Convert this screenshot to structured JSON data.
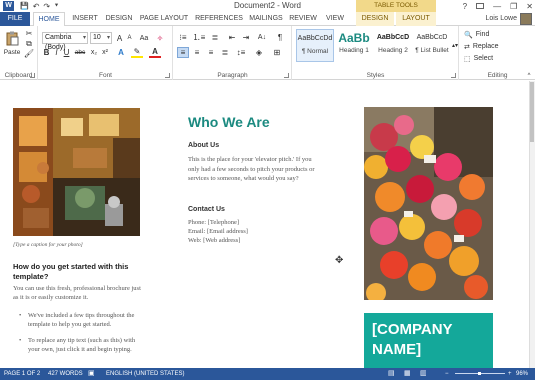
{
  "titlebar": {
    "app_icon": "W",
    "title": "Document2 - Word",
    "contextual_group": "TABLE TOOLS",
    "help": "?",
    "minimize": "—",
    "restore": "❐",
    "close": "✕"
  },
  "qat": {
    "save_icon": "💾",
    "undo_icon": "↶",
    "redo_icon": "↷",
    "more_icon": "⯆"
  },
  "tabs": {
    "file": "FILE",
    "home": "HOME",
    "insert": "INSERT",
    "design": "DESIGN",
    "page_layout": "PAGE LAYOUT",
    "references": "REFERENCES",
    "mailings": "MAILINGS",
    "review": "REVIEW",
    "view": "VIEW",
    "table_design": "DESIGN",
    "table_layout": "LAYOUT",
    "user": "Lois Lowe"
  },
  "ribbon": {
    "clipboard": {
      "label": "Clipboard",
      "paste": "Paste"
    },
    "font": {
      "label": "Font",
      "name": "Cambria (Body)",
      "size": "10",
      "grow": "A",
      "shrink": "A",
      "case": "Aa",
      "clear": "✧",
      "bold": "B",
      "italic": "I",
      "underline": "U",
      "strike": "abc",
      "sub": "x₂",
      "sup": "x²",
      "effects": "A",
      "highlight": "✎",
      "color": "A"
    },
    "paragraph": {
      "label": "Paragraph",
      "show_marks": "¶"
    },
    "styles": {
      "label": "Styles",
      "items": [
        {
          "sample": "AaBbCcDd",
          "name": "¶ Normal"
        },
        {
          "sample": "AaBb",
          "name": "Heading 1"
        },
        {
          "sample": "AaBbCcD",
          "name": "Heading 2"
        },
        {
          "sample": "AaBbCcD",
          "name": "¶ List Bullet"
        }
      ]
    },
    "editing": {
      "label": "Editing",
      "find": "Find",
      "replace": "Replace",
      "select": "Select"
    }
  },
  "document": {
    "caption": "[Type a caption for your photo]",
    "left_heading": "How do you get started with this template?",
    "left_body": "You can use this fresh, professional brochure just as it is or easily customize it.",
    "bullets": [
      "We've included a few tips throughout the template to help you get started.",
      "To replace any tip text (such as this) with your own, just click it and begin typing."
    ],
    "center_title": "Who We Are",
    "about_heading": "About Us",
    "about_body": "This is the place for your 'elevator pitch.' If you only had a few seconds to pitch your products or services to someone, what would you say?",
    "contact_heading": "Contact Us",
    "contact_phone": "Phone: [Telephone]",
    "contact_email": "Email: [Email address]",
    "contact_web": "Web: [Web address]",
    "company_line1": "[COMPANY",
    "company_line2": "NAME]"
  },
  "status": {
    "page": "PAGE 1 OF 2",
    "words": "427 WORDS",
    "language": "ENGLISH (UNITED STATES)",
    "zoom": "96%"
  }
}
